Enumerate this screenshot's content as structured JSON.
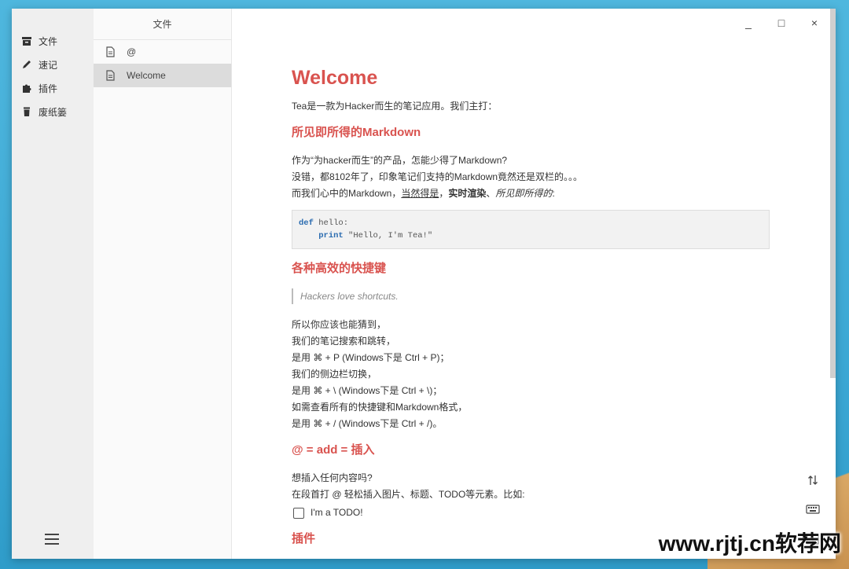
{
  "nav": {
    "items": [
      {
        "label": "文件",
        "icon": "archive-icon"
      },
      {
        "label": "速记",
        "icon": "pencil-icon"
      },
      {
        "label": "插件",
        "icon": "puzzle-icon"
      },
      {
        "label": "废纸篓",
        "icon": "trash-icon"
      }
    ],
    "menu_icon": "hamburger-icon"
  },
  "files": {
    "header": "文件",
    "items": [
      {
        "name": "@"
      },
      {
        "name": "Welcome"
      }
    ]
  },
  "window": {
    "minimize": "_",
    "maximize": "□",
    "close": "×"
  },
  "doc": {
    "title": "Welcome",
    "intro": "Tea是一款为Hacker而生的笔记应用。我们主打：",
    "h_markdown": "所见即所得的Markdown",
    "md_line1": "作为“为hacker而生”的产品，怎能少得了Markdown?",
    "md_line2": "没错，都8102年了，印象笔记们支持的Markdown竟然还是双栏的。。。",
    "md_line3_a": "而我们心中的Markdown，",
    "md_line3_u": "当然得是",
    "md_line3_sep1": "，",
    "md_line3_b": "实时渲染",
    "md_line3_sep2": "、",
    "md_line3_i": "所见即所得的",
    "md_line3_end": ":",
    "code_kw1": "def",
    "code_line1_rest": " hello:",
    "code_indent": "    ",
    "code_kw2": "print",
    "code_line2_rest": " \"Hello, I'm Tea!\"",
    "h_shortcuts": "各种高效的快捷键",
    "quote": "Hackers love shortcuts.",
    "sc_lines": [
      "所以你应该也能猜到，",
      "我们的笔记搜索和跳转，",
      "是用 ⌘ + P (Windows下是 Ctrl + P)；",
      "我们的侧边栏切换，",
      "是用 ⌘ + \\ (Windows下是 Ctrl + \\)；",
      "如需查看所有的快捷键和Markdown格式，",
      "是用 ⌘ + / (Windows下是 Ctrl + /)。"
    ],
    "h_add": "@ = add = 插入",
    "add_line1": "想插入任何内容吗?",
    "add_line2": "在段首打 @ 轻松插入图片、标题、TODO等元素。比如:",
    "todo_label": "I'm a TODO!",
    "h_plugins": "插件"
  },
  "tools": [
    "sort-icon",
    "keyboard-icon",
    "layout-icon"
  ],
  "watermark": "www.rjtj.cn软荐网"
}
